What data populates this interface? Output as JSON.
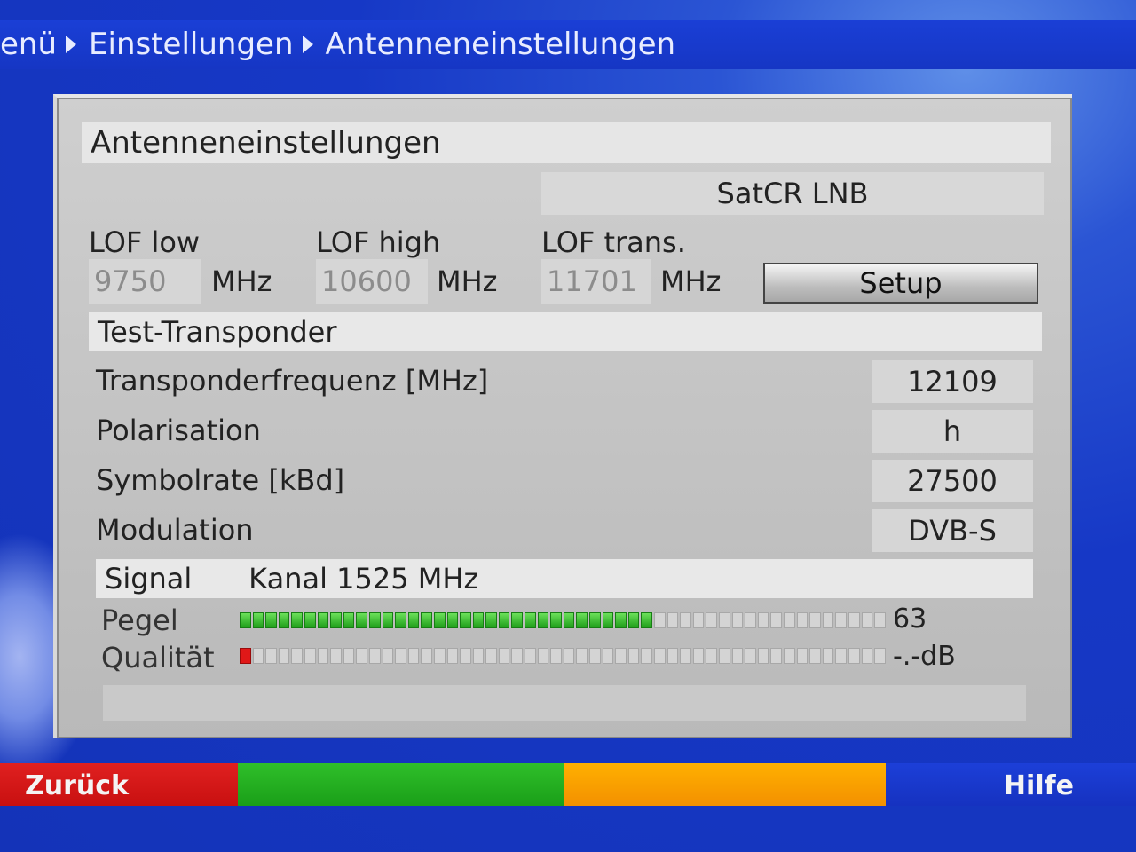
{
  "breadcrumb": {
    "items": [
      "enü",
      "Einstellungen",
      "Antenneneinstellungen"
    ]
  },
  "panel": {
    "title": "Antenneneinstellungen",
    "lnb_type": "SatCR LNB",
    "lof": {
      "low_label": "LOF low",
      "low_value": "9750",
      "high_label": "LOF high",
      "high_value": "10600",
      "trans_label": "LOF trans.",
      "trans_value": "11701",
      "unit": "MHz"
    },
    "setup_button": "Setup",
    "test_transponder": {
      "header": "Test-Transponder",
      "rows": [
        {
          "label": "Transponderfrequenz [MHz]",
          "value": "12109"
        },
        {
          "label": "Polarisation",
          "value": "h"
        },
        {
          "label": "Symbolrate [kBd]",
          "value": "27500"
        },
        {
          "label": "Modulation",
          "value": "DVB-S"
        }
      ]
    },
    "signal": {
      "label": "Signal",
      "channel": "Kanal 1525 MHz",
      "pegel_label": "Pegel",
      "pegel_value": "63",
      "pegel_fraction": 0.63,
      "qualitaet_label": "Qualität",
      "qualitaet_value": "-.-dB",
      "qualitaet_fraction": 0.01
    }
  },
  "footer": {
    "red": "Zurück",
    "green": "",
    "yellow": "",
    "blue": "Hilfe"
  },
  "colors": {
    "background": "#1638c6",
    "panel": "#c8c8c8",
    "bar_green": "#1f9f1a",
    "bar_red": "#e01818"
  }
}
